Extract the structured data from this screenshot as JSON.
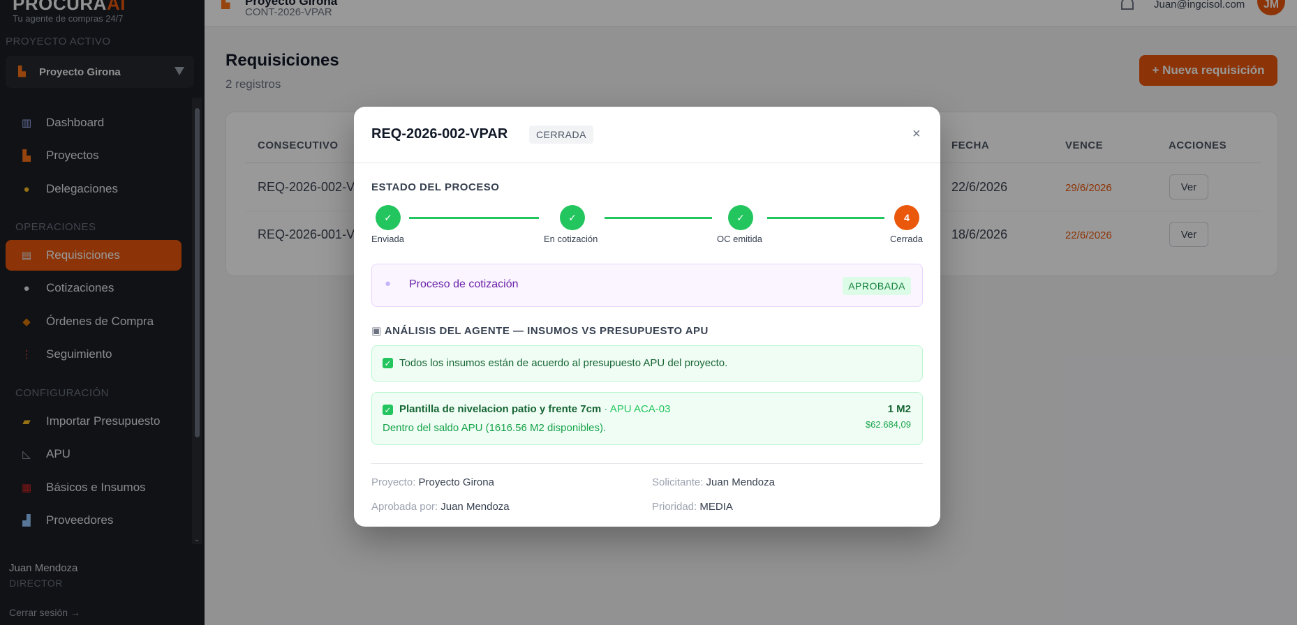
{
  "sidebar": {
    "brand": {
      "name": "PROCURA",
      "name_accent": "AI",
      "tagline": "Tu agente de compras 24/7"
    },
    "active_project_label": "PROYECTO ACTIVO",
    "project": {
      "name": "Proyecto Girona"
    },
    "main_items": [
      {
        "label": "Dashboard",
        "icon": "chart-icon"
      },
      {
        "label": "Proyectos",
        "icon": "building-icon"
      },
      {
        "label": "Delegaciones",
        "icon": "handshake-icon"
      }
    ],
    "operations_label": "OPERACIONES",
    "operations_items": [
      {
        "label": "Requisiciones",
        "icon": "clipboard-icon",
        "active": true
      },
      {
        "label": "Cotizaciones",
        "icon": "speech-bubble-icon"
      },
      {
        "label": "Órdenes de Compra",
        "icon": "box-icon"
      },
      {
        "label": "Seguimiento",
        "icon": "traffic-light-icon"
      }
    ],
    "config_label": "CONFIGURACIÓN",
    "config_items": [
      {
        "label": "Importar Presupuesto",
        "icon": "folder-icon"
      },
      {
        "label": "APU",
        "icon": "ruler-icon"
      },
      {
        "label": "Básicos e Insumos",
        "icon": "bricks-icon"
      },
      {
        "label": "Proveedores",
        "icon": "factory-icon"
      }
    ],
    "user": {
      "name": "Juan Mendoza",
      "role": "DIRECTOR"
    },
    "logout": "Cerrar sesión →"
  },
  "topbar": {
    "project_name": "Proyecto Girona",
    "project_code": "CONT-2026-VPAR",
    "email": "Juan@ingcisol.com",
    "avatar_initials": "JM"
  },
  "main": {
    "title": "Requisiciones",
    "count": "2 registros",
    "new_button": "+ Nueva requisición",
    "columns": {
      "consecutivo": "CONSECUTIVO",
      "fecha": "FECHA",
      "vence": "VENCE",
      "acciones": "ACCIONES"
    },
    "rows": [
      {
        "consecutivo": "REQ-2026-002-V",
        "fecha": "22/6/2026",
        "vence": "29/6/2026",
        "action": "Ver"
      },
      {
        "consecutivo": "REQ-2026-001-V",
        "fecha": "18/6/2026",
        "vence": "22/6/2026",
        "action": "Ver"
      }
    ]
  },
  "modal": {
    "title": "REQ-2026-002-VPAR",
    "status": "CERRADA",
    "close": "×",
    "process_label": "ESTADO DEL PROCESO",
    "steps": [
      {
        "label": "Enviada",
        "done": true
      },
      {
        "label": "En cotización",
        "done": true
      },
      {
        "label": "OC emitida",
        "done": true
      },
      {
        "label": "Cerrada",
        "number": "4",
        "current": true
      }
    ],
    "quote": {
      "label": "Proceso de cotización",
      "status": "APROBADA"
    },
    "analysis_label": "ANÁLISIS DEL AGENTE — INSUMOS VS PRESUPUESTO APU",
    "analysis_ok": "Todos los insumos están de acuerdo al presupuesto APU del proyecto.",
    "item": {
      "name": "Plantilla de nivelacion patio y frente 7cm",
      "apu": " · APU ACA-03",
      "note": "Dentro del saldo APU (1616.56 M2 disponibles).",
      "qty": "1 M2",
      "price": "$62.684,09"
    },
    "meta": {
      "proyecto_label": "Proyecto:",
      "proyecto": "Proyecto Girona",
      "solicitante_label": "Solicitante:",
      "solicitante": "Juan Mendoza",
      "aprobada_label": "Aprobada por:",
      "aprobada": "Juan Mendoza",
      "prioridad_label": "Prioridad:",
      "prioridad": "MEDIA"
    }
  },
  "colors": {
    "accent": "#ea580c",
    "success": "#22c55e",
    "sidebar": "#1c1e23"
  }
}
